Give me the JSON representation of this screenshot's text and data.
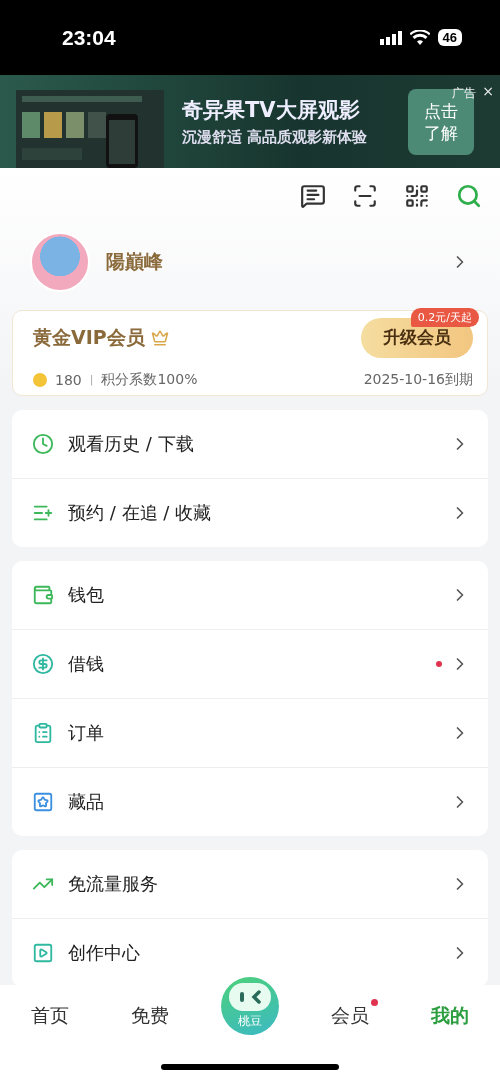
{
  "status_bar": {
    "time": "23:04",
    "battery": "46"
  },
  "ad": {
    "title": "奇异果TV大屏观影",
    "subtitle": "沉漫舒适 高品质观影新体验",
    "button": "点击了解",
    "tag": "广告",
    "close": "×"
  },
  "profile": {
    "name": "陽巔峰"
  },
  "vip": {
    "title": "黄金VIP会员",
    "points": "180",
    "divider": "|",
    "coefficient": "积分系数100%",
    "upgrade": "升级会员",
    "price_badge": "0.2元/天起",
    "expiry": "2025-10-16到期"
  },
  "menu_groups": [
    [
      {
        "kind": "history",
        "label": "观看历史 / 下载",
        "dot": false
      },
      {
        "kind": "reserve",
        "label": "预约 / 在追 / 收藏",
        "dot": false
      }
    ],
    [
      {
        "kind": "wallet",
        "label": "钱包",
        "dot": false
      },
      {
        "kind": "loan",
        "label": "借钱",
        "dot": true
      },
      {
        "kind": "order",
        "label": "订单",
        "dot": false
      },
      {
        "kind": "collection",
        "label": "藏品",
        "dot": false
      }
    ],
    [
      {
        "kind": "traffic",
        "label": "免流量服务",
        "dot": false
      },
      {
        "kind": "creator",
        "label": "创作中心",
        "dot": false
      }
    ]
  ],
  "tab_bar": [
    {
      "kind": "text",
      "label": "首页",
      "selected": false,
      "dot": false
    },
    {
      "kind": "text",
      "label": "免费",
      "selected": false,
      "dot": false
    },
    {
      "kind": "center",
      "label": "桃豆",
      "selected": false,
      "dot": false
    },
    {
      "kind": "text",
      "label": "会员",
      "selected": false,
      "dot": true
    },
    {
      "kind": "text",
      "label": "我的",
      "selected": true,
      "dot": false
    }
  ]
}
